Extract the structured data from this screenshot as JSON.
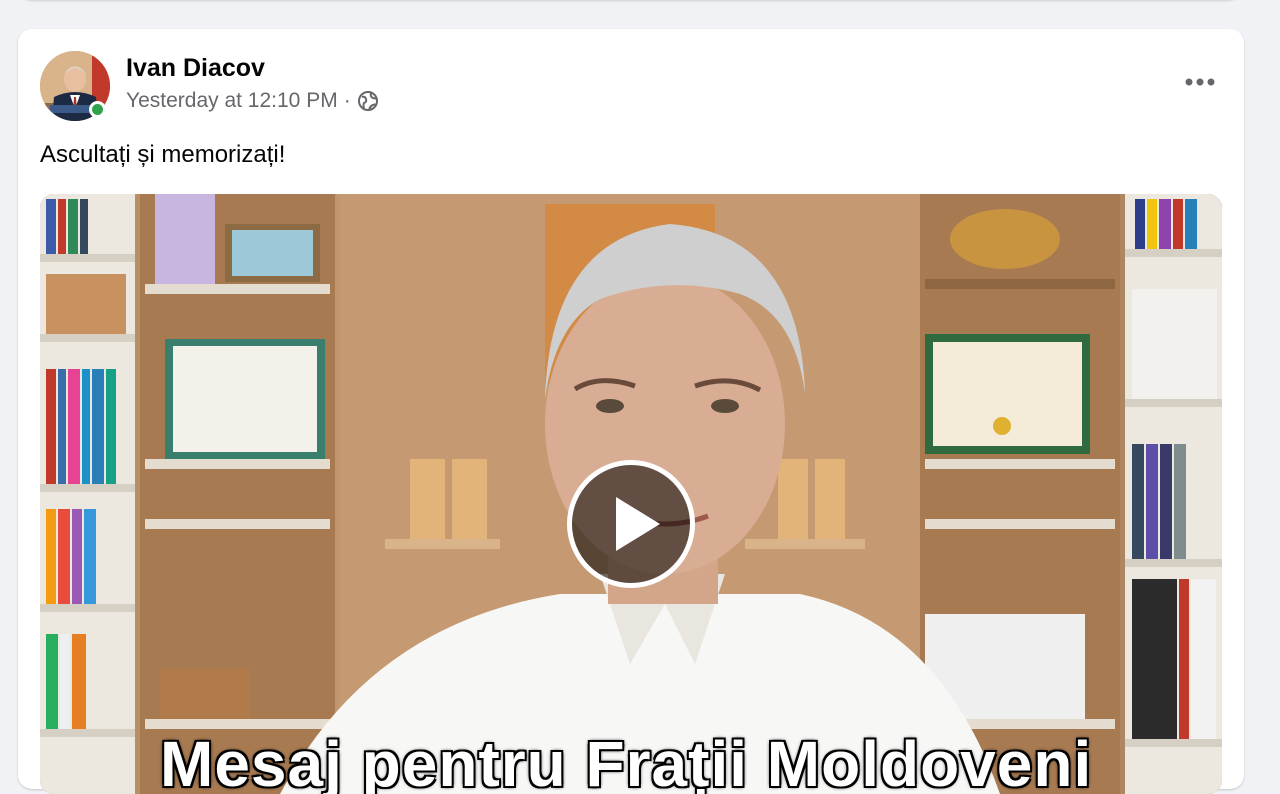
{
  "post": {
    "author": "Ivan Diacov",
    "timestamp": "Yesterday at 12:10 PM",
    "separator": "·",
    "audience_icon": "globe-icon",
    "more_icon": "more-horizontal-icon",
    "text": "Ascultați și memorizați!",
    "online": true
  },
  "video": {
    "caption": "Mesaj pentru Frații Moldoveni",
    "play_icon": "play-icon"
  },
  "colors": {
    "background": "#f0f2f5",
    "card": "#ffffff",
    "name": "#050505",
    "meta": "#65676b",
    "online": "#31a24c"
  }
}
